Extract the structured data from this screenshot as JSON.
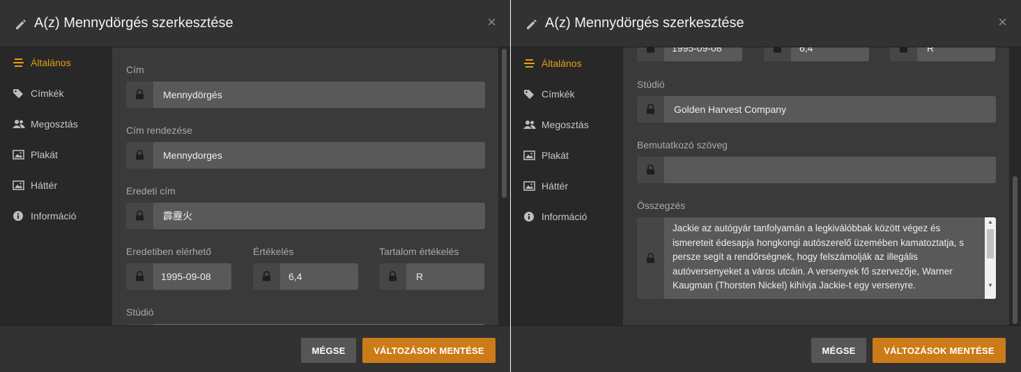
{
  "dialog": {
    "title": "A(z) Mennydörgés szerkesztése",
    "close_glyph": "×",
    "accent_color": "#e5a00d",
    "save_color": "#cc7b19"
  },
  "sidebar": {
    "items": [
      {
        "label": "Általános",
        "icon": "list-icon",
        "active": true
      },
      {
        "label": "Címkék",
        "icon": "tag-icon"
      },
      {
        "label": "Megosztás",
        "icon": "users-icon"
      },
      {
        "label": "Plakát",
        "icon": "image-icon"
      },
      {
        "label": "Háttér",
        "icon": "image-icon"
      },
      {
        "label": "Információ",
        "icon": "info-icon"
      }
    ]
  },
  "fields": {
    "title_label": "Cím",
    "title_value": "Mennydörgés",
    "sort_title_label": "Cím rendezése",
    "sort_title_value": "Mennydorges",
    "original_title_label": "Eredeti cím",
    "original_title_value": "霹靂火",
    "release_label": "Eredetiben elérhető",
    "release_value": "1995-09-08",
    "rating_label": "Értékelés",
    "rating_value": "6,4",
    "content_rating_label": "Tartalom értékelés",
    "content_rating_value": "R",
    "studio_label": "Stúdió",
    "studio_value": "Golden Harvest Company",
    "tagline_label": "Bemutatkozó szöveg",
    "tagline_value": "",
    "summary_label": "Összegzés",
    "summary_value": "Jackie az autógyár tanfolyamán a legkiválóbbak között végez és ismereteit édesapja hongkongi autószerelő üzemében kamatoztatja, s persze segít a rendőrségnek, hogy felszámolják az illegális autóversenyeket a város utcáin. A versenyek fő szervezője, Warner Kaugman (Thorsten Nickel) kihívja Jackie-t egy versenyre."
  },
  "footer": {
    "cancel_label": "MÉGSE",
    "save_label": "VÁLTOZÁSOK MENTÉSE"
  }
}
